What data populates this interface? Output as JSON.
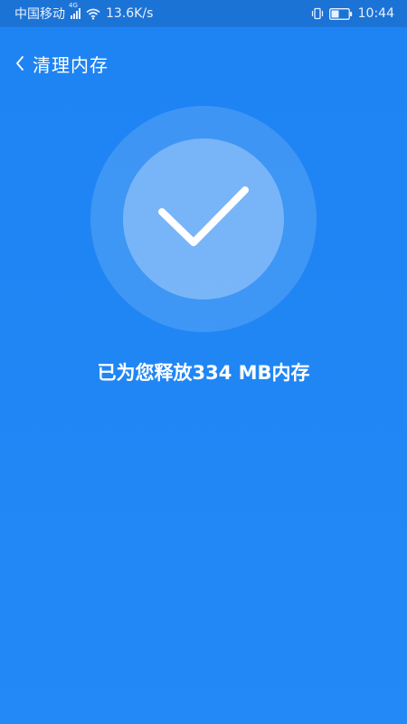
{
  "status_bar": {
    "carrier": "中国移动",
    "network_type": "4G",
    "speed": "13.6K/s",
    "time": "10:44"
  },
  "header": {
    "title": "清理内存"
  },
  "result": {
    "message": "已为您释放334 MB内存"
  },
  "colors": {
    "background": "#1e83f3",
    "status_bar": "#1c73d6"
  },
  "icons": {
    "back": "back-arrow-icon",
    "check": "checkmark-icon",
    "signal": "signal-icon",
    "wifi": "wifi-icon",
    "vibrate": "vibrate-icon",
    "battery": "battery-icon"
  }
}
